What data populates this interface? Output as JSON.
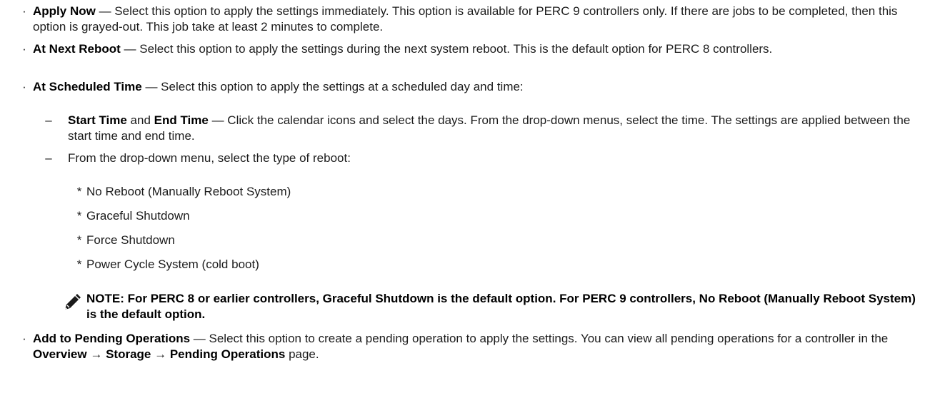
{
  "items": [
    {
      "marker": "·",
      "title": "Apply Now",
      "dash": " — ",
      "body": "Select this option to apply the settings immediately. This option is available for PERC 9 controllers only. If there are jobs to be completed, then this option is grayed-out. This job take at least 2 minutes to complete."
    },
    {
      "marker": "·",
      "title": "At Next Reboot",
      "dash": " — ",
      "body": "Select this option to apply the settings during the next system reboot. This is the default option for PERC 8 controllers."
    },
    {
      "marker": "·",
      "title": "At Scheduled Time",
      "dash": " — ",
      "body": "Select this option to apply the settings at a scheduled day and time:"
    }
  ],
  "sub_items": [
    {
      "marker": "–",
      "title_a": "Start Time",
      "joiner": " and ",
      "title_b": "End Time",
      "dash": " — ",
      "body": "Click the calendar icons and select the days. From the drop-down menus, select the time. The settings are applied between the start time and end time."
    },
    {
      "marker": "–",
      "body": "From the drop-down menu, select the type of reboot:"
    }
  ],
  "reboot_options": {
    "marker": "*",
    "labels": [
      "No Reboot (Manually Reboot System)",
      "Graceful Shutdown",
      "Force Shutdown",
      "Power Cycle System (cold boot)"
    ]
  },
  "note": {
    "icon": "pencil-icon",
    "text": "NOTE: For PERC 8 or earlier controllers, Graceful Shutdown is the default option. For PERC 9 controllers, No Reboot (Manually Reboot System) is the default option."
  },
  "last_item": {
    "marker": "·",
    "title": "Add to Pending Operations",
    "dash": " — ",
    "body": "Select this option to create a pending operation to apply the settings. You can view all pending operations for a controller in the ",
    "path_1": "Overview",
    "arrow": " → ",
    "path_2": "Storage",
    "path_3": "Pending Operations",
    "tail": " page."
  }
}
